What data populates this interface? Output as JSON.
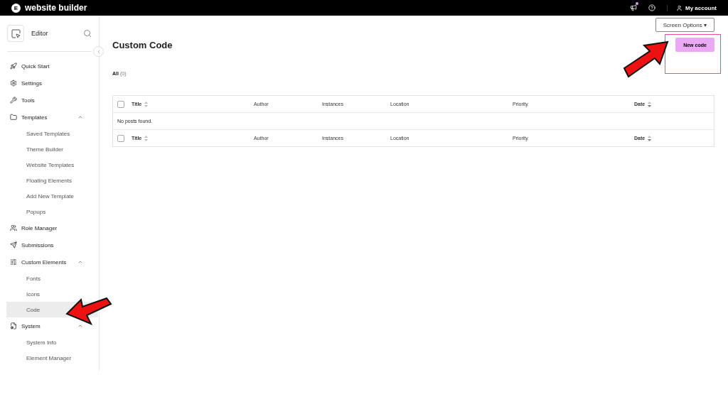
{
  "topbar": {
    "logo_mark": "E",
    "brand": "website builder",
    "account": "My account"
  },
  "sidebar": {
    "header": "Editor",
    "items": [
      {
        "label": "Quick Start",
        "selected": false
      },
      {
        "label": "Settings",
        "selected": false
      },
      {
        "label": "Tools",
        "selected": false
      },
      {
        "label": "Templates",
        "selected": false,
        "expanded": true,
        "children": [
          {
            "label": "Saved Templates",
            "selected": false
          },
          {
            "label": "Theme Builder",
            "selected": false
          },
          {
            "label": "Website Templates",
            "selected": false
          },
          {
            "label": "Floating Elements",
            "selected": false
          },
          {
            "label": "Add New Template",
            "selected": false
          },
          {
            "label": "Popups",
            "selected": false
          }
        ]
      },
      {
        "label": "Role Manager",
        "selected": false
      },
      {
        "label": "Submissions",
        "selected": false
      },
      {
        "label": "Custom Elements",
        "selected": false,
        "expanded": true,
        "children": [
          {
            "label": "Fonts",
            "selected": false
          },
          {
            "label": "Icons",
            "selected": false
          },
          {
            "label": "Code",
            "selected": true
          }
        ]
      },
      {
        "label": "System",
        "selected": false,
        "expanded": true,
        "children": [
          {
            "label": "System Info",
            "selected": false
          },
          {
            "label": "Element Manager",
            "selected": false
          }
        ]
      }
    ]
  },
  "main": {
    "screen_options": "Screen Options",
    "screen_options_caret": "▾",
    "title": "Custom Code",
    "new_button": "New code",
    "filter": {
      "label": "All",
      "count": "(0)"
    },
    "table": {
      "columns": [
        {
          "label": "Title",
          "sortable": true
        },
        {
          "label": "Author",
          "sortable": false
        },
        {
          "label": "Instances",
          "sortable": false
        },
        {
          "label": "Location",
          "sortable": false
        },
        {
          "label": "Priority",
          "sortable": false
        },
        {
          "label": "Date",
          "sortable": true
        }
      ],
      "header_checked": false,
      "empty_message": "No posts found.",
      "footer_columns": [
        {
          "label": "Title",
          "sortable": true
        },
        {
          "label": "Author",
          "sortable": false
        },
        {
          "label": "Instances",
          "sortable": false
        },
        {
          "label": "Location",
          "sortable": false
        },
        {
          "label": "Priority",
          "sortable": false
        },
        {
          "label": "Date",
          "sortable": true
        }
      ],
      "footer_checked": false
    }
  }
}
